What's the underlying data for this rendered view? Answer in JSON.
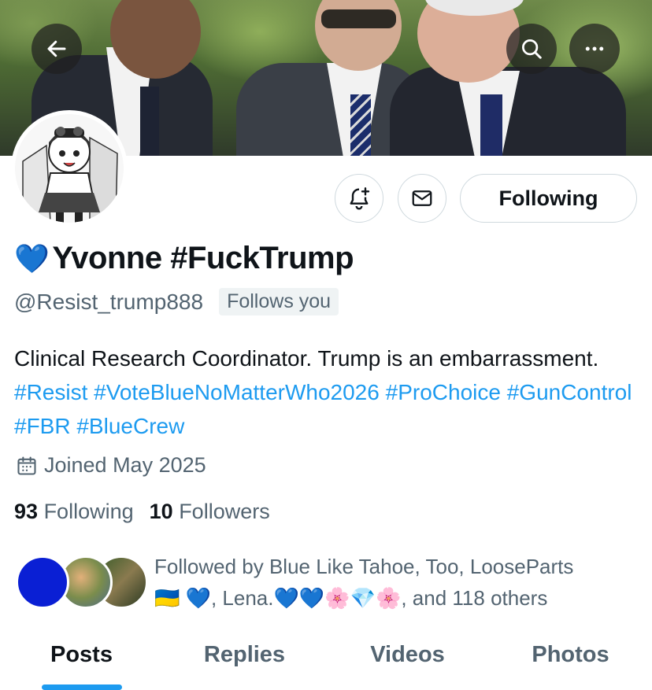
{
  "header": {
    "banner_description_icons": [
      "back-arrow-icon",
      "search-icon",
      "more-icon"
    ]
  },
  "profile": {
    "name_emoji": "💙",
    "name_text": "Yvonne #FuckTrump",
    "handle": "@Resist_trump888",
    "follows_you": "Follows you",
    "bio_plain": "Clinical Research Coordinator. Trump is an embarrassment.",
    "bio_tags": [
      "#Resist",
      "#VoteBlueNoMatterWho2026",
      "#ProChoice",
      "#GunControl",
      "#FBR",
      "#BlueCrew"
    ],
    "joined": "Joined May 2025",
    "following_count": "93",
    "following_label": "Following",
    "followers_count": "10",
    "followers_label": "Followers"
  },
  "actions": {
    "following_button": "Following"
  },
  "followed_by": {
    "text_line1": "Followed by Blue Like Tahoe, Too, LooseParts",
    "text_line2": "🇺🇦 💙, Lena.💙💙🌸💎🌸, and 118 others"
  },
  "tabs": [
    {
      "label": "Posts",
      "active": true
    },
    {
      "label": "Replies",
      "active": false
    },
    {
      "label": "Videos",
      "active": false
    },
    {
      "label": "Photos",
      "active": false
    }
  ],
  "colors": {
    "accent": "#1d9bf0",
    "text": "#0f1419",
    "secondary": "#536471",
    "border": "#cfd9de"
  }
}
